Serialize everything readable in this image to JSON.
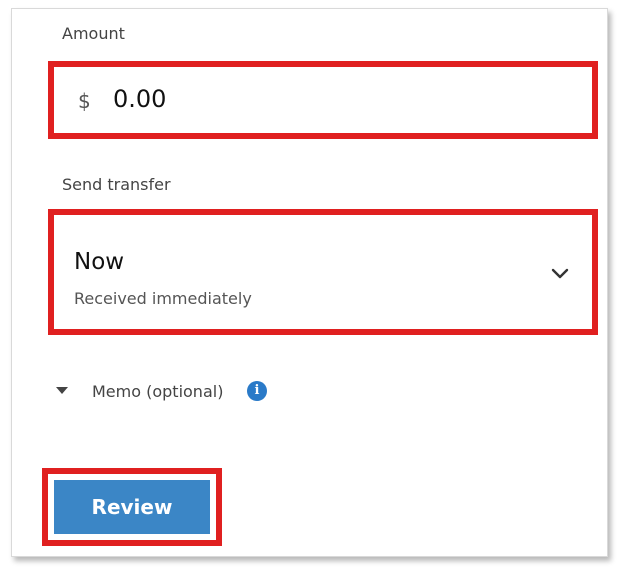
{
  "amount": {
    "label": "Amount",
    "currency_symbol": "$",
    "value": "0.00"
  },
  "send_transfer": {
    "label": "Send transfer",
    "selected_value": "Now",
    "selected_description": "Received immediately"
  },
  "memo": {
    "label": "Memo (optional)",
    "info_glyph": "i"
  },
  "actions": {
    "review_label": "Review"
  },
  "colors": {
    "highlight_border": "#e02020",
    "primary_button": "#3b86c6",
    "info_icon": "#2a7ac8"
  },
  "icons": {
    "transfer_dropdown": "chevron-down-icon",
    "memo_toggle": "caret-down-icon",
    "memo_info": "info-icon"
  }
}
